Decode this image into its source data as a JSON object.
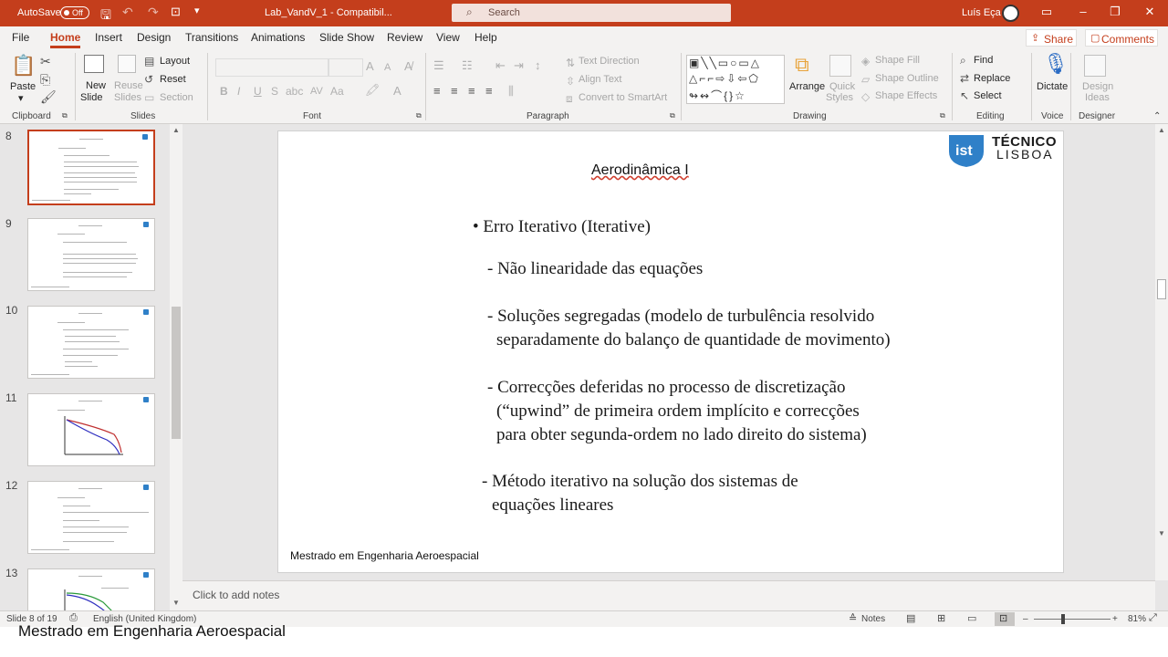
{
  "titlebar": {
    "autosave_label": "AutoSave",
    "autosave_state": "Off",
    "document_title": "Lab_VandV_1 - Compatibil...",
    "search_placeholder": "Search",
    "user_name": "Luís Eça"
  },
  "menu": {
    "tabs": [
      "File",
      "Home",
      "Insert",
      "Design",
      "Transitions",
      "Animations",
      "Slide Show",
      "Review",
      "View",
      "Help"
    ],
    "active_tab": "Home",
    "share_label": "Share",
    "comments_label": "Comments"
  },
  "ribbon": {
    "clipboard": {
      "paste": "Paste",
      "group": "Clipboard"
    },
    "slides": {
      "new_slide_1": "New",
      "new_slide_2": "Slide",
      "reuse_1": "Reuse",
      "reuse_2": "Slides",
      "layout": "Layout",
      "reset": "Reset",
      "section": "Section",
      "group": "Slides"
    },
    "font": {
      "group": "Font"
    },
    "paragraph": {
      "text_direction": "Text Direction",
      "align_text": "Align Text",
      "convert_smartart": "Convert to SmartArt",
      "group": "Paragraph"
    },
    "drawing": {
      "arrange": "Arrange",
      "quick_styles_1": "Quick",
      "quick_styles_2": "Styles",
      "shape_fill": "Shape Fill",
      "shape_outline": "Shape Outline",
      "shape_effects": "Shape Effects",
      "group": "Drawing"
    },
    "editing": {
      "find": "Find",
      "replace": "Replace",
      "select": "Select",
      "group": "Editing"
    },
    "voice": {
      "dictate": "Dictate",
      "group": "Voice"
    },
    "designer": {
      "design_ideas_1": "Design",
      "design_ideas_2": "Ideas",
      "group": "Designer"
    }
  },
  "thumbnails": [
    {
      "number": "8",
      "selected": true
    },
    {
      "number": "9",
      "selected": false
    },
    {
      "number": "10",
      "selected": false
    },
    {
      "number": "11",
      "selected": false
    },
    {
      "number": "12",
      "selected": false
    },
    {
      "number": "13",
      "selected": false
    }
  ],
  "slide": {
    "title": "Aerodinâmica I",
    "logo_line1": "TÉCNICO",
    "logo_line2": "LISBOA",
    "bullet": "• Erro Iterativo (Iterative)",
    "line1": "- Não linearidade das equações",
    "line2a": "- Soluções segregadas (modelo de turbulência resolvido",
    "line2b": "separadamente do balanço de quantidade de movimento)",
    "line3a": "- Correcções deferidas no processo de discretização",
    "line3b": "(“upwind” de primeira ordem implícito e correcções",
    "line3c": "para obter segunda-ordem no lado direito do sistema)",
    "line4a": "- Método iterativo na solução dos sistemas de",
    "line4b": "equações lineares",
    "footer": "Mestrado em Engenharia Aeroespacial"
  },
  "notes_placeholder": "Click to add notes",
  "status": {
    "slide_count": "Slide 8 of 19",
    "language": "English (United Kingdom)",
    "notes_label": "Notes",
    "zoom": "81%"
  },
  "caption": "Mestrado em Engenharia Aeroespacial",
  "colors": {
    "accent": "#c43e1c",
    "logo_blue": "#2f80c8"
  }
}
